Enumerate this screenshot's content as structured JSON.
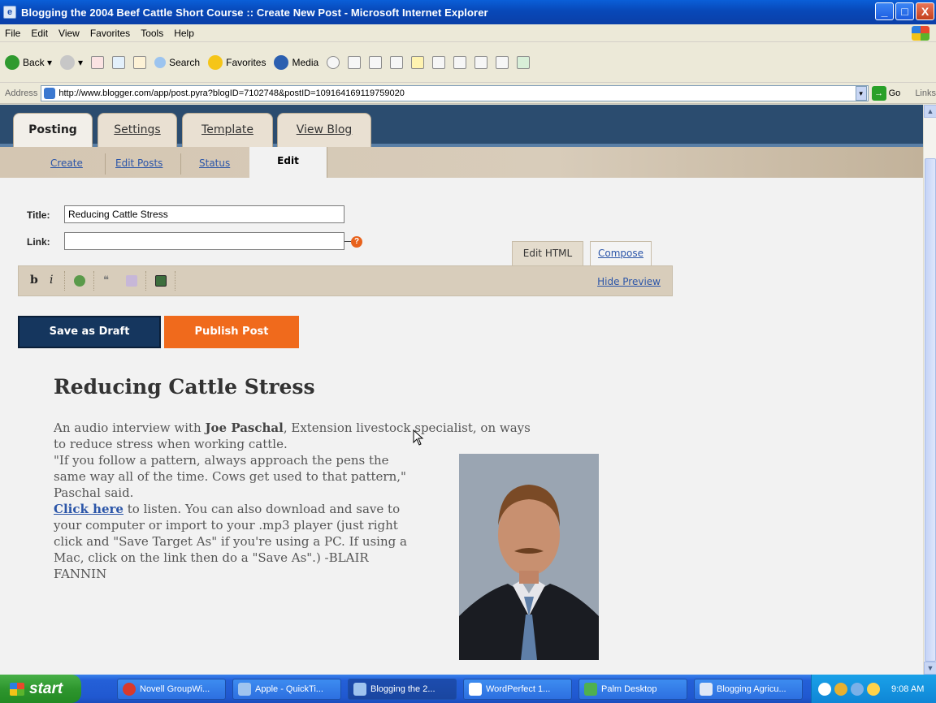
{
  "window": {
    "title": "Blogging the 2004 Beef Cattle Short Course :: Create New Post - Microsoft Internet Explorer",
    "controls": [
      "_",
      "□",
      "X"
    ]
  },
  "menu": [
    "File",
    "Edit",
    "View",
    "Favorites",
    "Tools",
    "Help"
  ],
  "toolbar": {
    "back": "Back",
    "search": "Search",
    "favorites": "Favorites",
    "media": "Media"
  },
  "address": {
    "label": "Address",
    "url": "http://www.blogger.com/app/post.pyra?blogID=7102748&postID=109164169119759020",
    "go": "Go",
    "links": "Links"
  },
  "blogger": {
    "tabs": [
      "Posting",
      "Settings",
      "Template",
      "View Blog"
    ],
    "subtabs": [
      "Create",
      "Edit Posts",
      "Status",
      "Edit"
    ],
    "title_label": "Title:",
    "title_value": "Reducing Cattle Stress",
    "link_label": "Link:",
    "link_value": "",
    "editor_tabs": [
      "Edit HTML",
      "Compose"
    ],
    "hide_preview": "Hide Preview",
    "save_draft": "Save as Draft",
    "publish": "Publish Post"
  },
  "preview": {
    "title": "Reducing Cattle Stress",
    "p1_a": "An audio interview with ",
    "p1_bold": "Joe Paschal",
    "p1_b": ", Extension livestock specialist, on ways",
    "p1_c": "to reduce stress when working cattle.",
    "p2_1": "\"If you follow a pattern, always approach the pens the",
    "p2_2": "same way all of the time. Cows get used to that pattern,\"",
    "p2_3": "Paschal said.",
    "link_text": "Click here",
    "p3_1": " to listen. You can also download and save to",
    "p3_2": "your computer or import to your .mp3 player (just right",
    "p3_3": "click and \"Save Target As\" if you're using a PC. If using a",
    "p3_4": "Mac, click on the link then do a \"Save As\".) -BLAIR",
    "p3_5": "FANNIN"
  },
  "taskbar": {
    "start": "start",
    "tasks": [
      "Novell GroupWi...",
      "Apple - QuickTi...",
      "Blogging the 2...",
      "WordPerfect 1...",
      "Palm Desktop",
      "Blogging Agricu..."
    ],
    "clock": "9:08 AM"
  },
  "colors": {
    "header": "#2b4c6f",
    "draft_button": "#15365e",
    "publish_button": "#f06a1c",
    "link": "#2b55a8"
  }
}
